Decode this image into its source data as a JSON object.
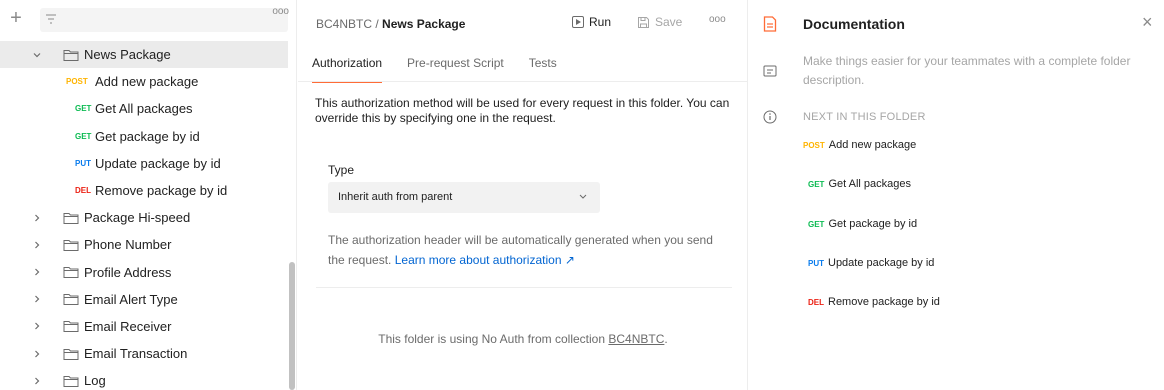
{
  "sidebar": {
    "filter_placeholder": "",
    "more_label": "ooo",
    "add_label": "+",
    "folders_top": [
      {
        "label": "News Package"
      }
    ],
    "requests": [
      {
        "method": "POST",
        "label": "Add new package"
      },
      {
        "method": "GET",
        "label": "Get All packages"
      },
      {
        "method": "GET",
        "label": "Get package by id"
      },
      {
        "method": "PUT",
        "label": "Update package by id"
      },
      {
        "method": "DEL",
        "label": "Remove package by id"
      }
    ],
    "folders": [
      {
        "label": "Package Hi-speed"
      },
      {
        "label": "Phone Number"
      },
      {
        "label": "Profile Address"
      },
      {
        "label": "Email Alert Type"
      },
      {
        "label": "Email Receiver"
      },
      {
        "label": "Email Transaction"
      },
      {
        "label": "Log"
      }
    ]
  },
  "header": {
    "collection": "BC4NBTC",
    "separator": "/",
    "folder": "News Package",
    "run_label": "Run",
    "save_label": "Save",
    "more_label": "ooo"
  },
  "tabs": [
    {
      "label": "Authorization",
      "active": true
    },
    {
      "label": "Pre-request Script",
      "active": false
    },
    {
      "label": "Tests",
      "active": false
    }
  ],
  "auth": {
    "description": "This authorization method will be used for every request in this folder. You can override this by specifying one in the request.",
    "type_label": "Type",
    "type_value": "Inherit auth from parent",
    "note": "The authorization header will be automatically generated when you send the request.",
    "link_label": "Learn more about authorization ↗",
    "noauth_prefix": "This folder is using No Auth from collection",
    "noauth_collection": "BC4NBTC",
    "noauth_suffix": "."
  },
  "docs": {
    "title": "Documentation",
    "close": "×",
    "description": "Make things easier for your teammates with a complete folder description.",
    "next_heading": "NEXT IN THIS FOLDER",
    "items": [
      {
        "method": "POST",
        "label": "Add new package"
      },
      {
        "method": "GET",
        "label": "Get All packages"
      },
      {
        "method": "GET",
        "label": "Get package by id"
      },
      {
        "method": "PUT",
        "label": "Update package by id"
      },
      {
        "method": "DEL",
        "label": "Remove package by id"
      }
    ]
  },
  "colors": {
    "accent": "#ff6c37",
    "post": "#ffb400",
    "get": "#0cbb52",
    "put": "#097bed",
    "del": "#eb2013",
    "link": "#0265d2"
  }
}
